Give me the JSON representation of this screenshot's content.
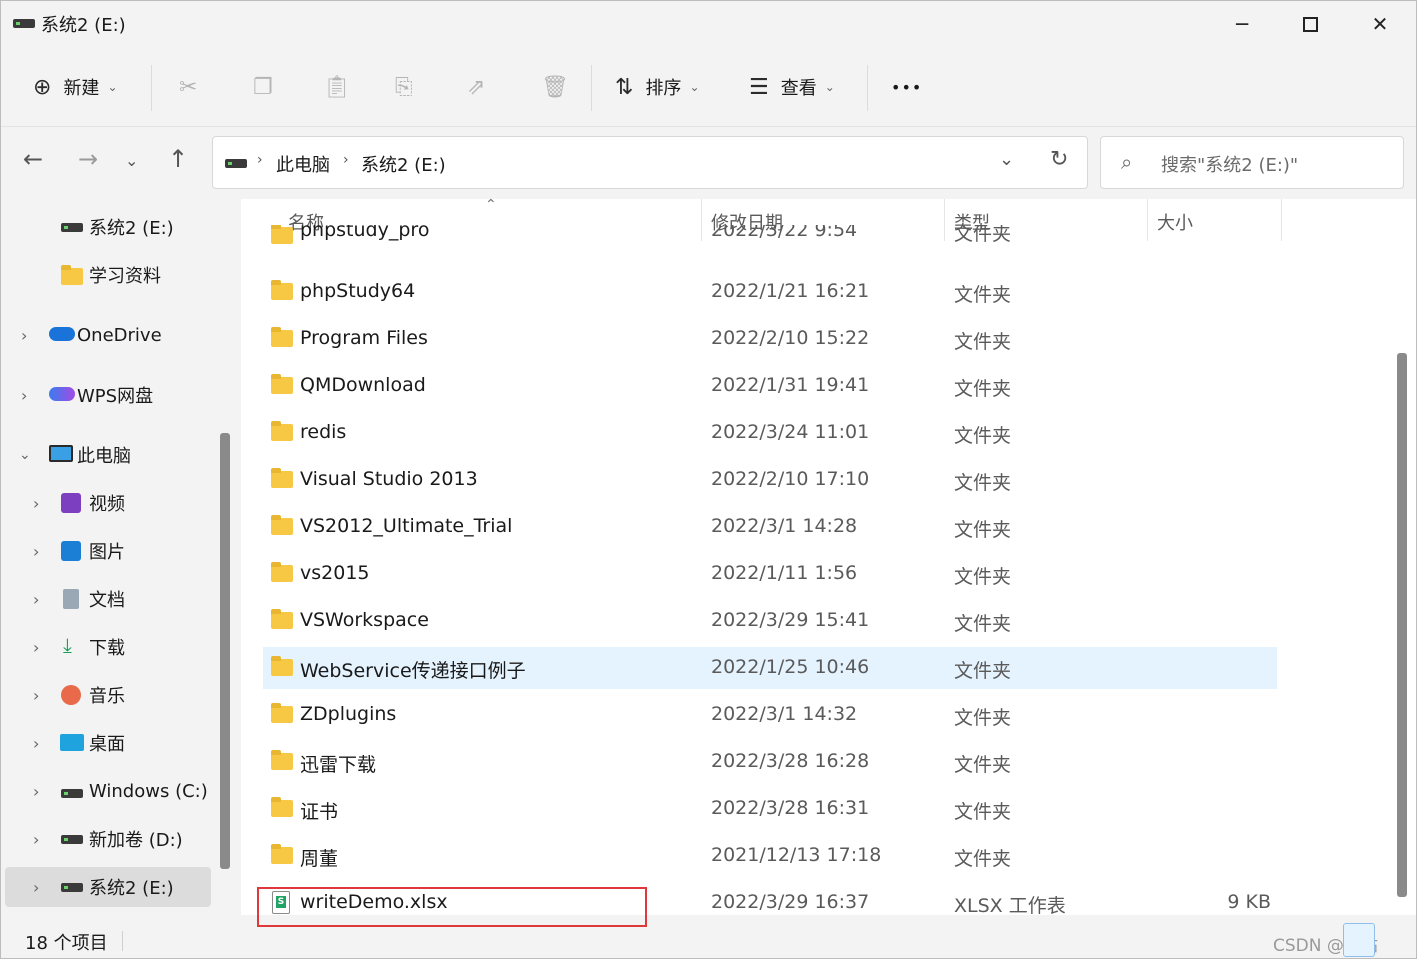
{
  "window": {
    "title": "系统2 (E:)"
  },
  "toolbar": {
    "new_label": "新建",
    "sort_label": "排序",
    "view_label": "查看",
    "more_label": "•••"
  },
  "address": {
    "crumbs": [
      "此电脑",
      "系统2 (E:)"
    ]
  },
  "search": {
    "placeholder": "搜索\"系统2 (E:)\""
  },
  "sidebar": {
    "items": [
      {
        "label": "系统2 (E:)",
        "icon": "drive-icon"
      },
      {
        "label": "学习资料",
        "icon": "folder-icon"
      },
      {
        "label": "OneDrive",
        "icon": "onedrive-icon"
      },
      {
        "label": "WPS网盘",
        "icon": "wps-cloud-icon"
      },
      {
        "label": "此电脑",
        "icon": "this-pc-icon"
      },
      {
        "label": "视频",
        "icon": "video-icon"
      },
      {
        "label": "图片",
        "icon": "pictures-icon"
      },
      {
        "label": "文档",
        "icon": "documents-icon"
      },
      {
        "label": "下载",
        "icon": "download-icon"
      },
      {
        "label": "音乐",
        "icon": "music-icon"
      },
      {
        "label": "桌面",
        "icon": "desktop-icon"
      },
      {
        "label": "Windows (C:)",
        "icon": "windows-drive-icon"
      },
      {
        "label": "新加卷 (D:)",
        "icon": "drive-icon"
      },
      {
        "label": "系统2 (E:)",
        "icon": "drive-icon"
      }
    ]
  },
  "columns": {
    "name": "名称",
    "date": "修改日期",
    "type": "类型",
    "size": "大小"
  },
  "files": [
    {
      "name": "phpstudy_pro",
      "date": "2022/3/22 9:54",
      "type": "文件夹",
      "size": ""
    },
    {
      "name": "phpStudy64",
      "date": "2022/1/21 16:21",
      "type": "文件夹",
      "size": ""
    },
    {
      "name": "Program Files",
      "date": "2022/2/10 15:22",
      "type": "文件夹",
      "size": ""
    },
    {
      "name": "QMDownload",
      "date": "2022/1/31 19:41",
      "type": "文件夹",
      "size": ""
    },
    {
      "name": "redis",
      "date": "2022/3/24 11:01",
      "type": "文件夹",
      "size": ""
    },
    {
      "name": "Visual Studio 2013",
      "date": "2022/2/10 17:10",
      "type": "文件夹",
      "size": ""
    },
    {
      "name": "VS2012_Ultimate_Trial",
      "date": "2022/3/1 14:28",
      "type": "文件夹",
      "size": ""
    },
    {
      "name": "vs2015",
      "date": "2022/1/11 1:56",
      "type": "文件夹",
      "size": ""
    },
    {
      "name": "VSWorkspace",
      "date": "2022/3/29 15:41",
      "type": "文件夹",
      "size": ""
    },
    {
      "name": "WebService传递接口例子",
      "date": "2022/1/25 10:46",
      "type": "文件夹",
      "size": ""
    },
    {
      "name": "ZDplugins",
      "date": "2022/3/1 14:32",
      "type": "文件夹",
      "size": ""
    },
    {
      "name": "迅雷下载",
      "date": "2022/3/28 16:28",
      "type": "文件夹",
      "size": ""
    },
    {
      "name": "证书",
      "date": "2022/3/28 16:31",
      "type": "文件夹",
      "size": ""
    },
    {
      "name": "周董",
      "date": "2021/12/13 17:18",
      "type": "文件夹",
      "size": ""
    },
    {
      "name": "writeDemo.xlsx",
      "date": "2022/3/29 16:37",
      "type": "XLSX 工作表",
      "size": "9 KB"
    }
  ],
  "status": {
    "count": "18 个项目"
  },
  "watermark": "CSDN @佳佑"
}
